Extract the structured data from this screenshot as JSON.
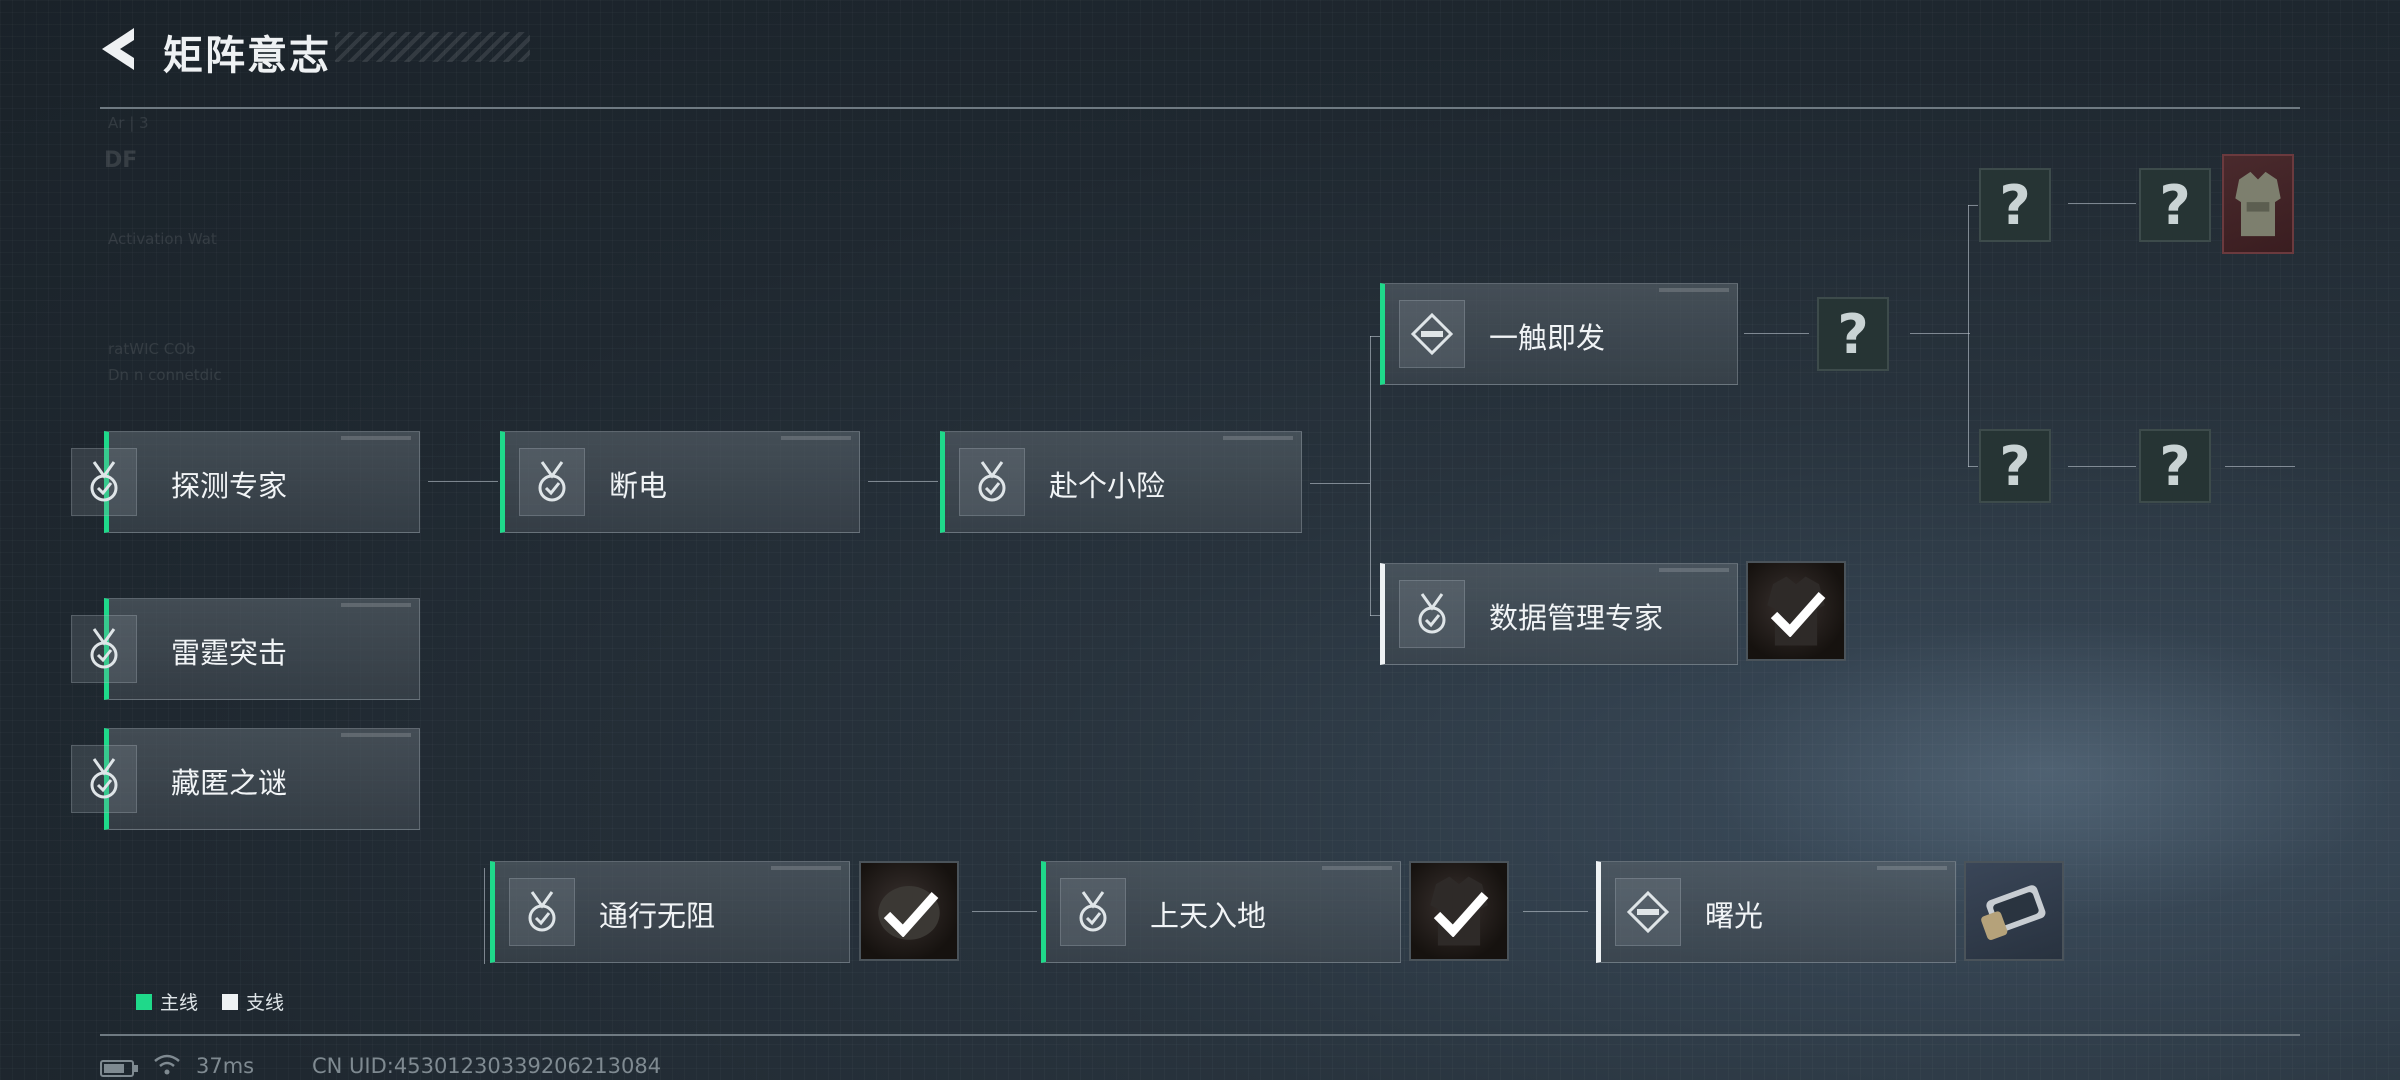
{
  "header": {
    "title": "矩阵意志"
  },
  "nodes": {
    "tance": {
      "label": "探测专家",
      "line": "main",
      "icon": "medal-check-icon"
    },
    "duandian": {
      "label": "断电",
      "line": "main",
      "icon": "medal-check-icon"
    },
    "fuge": {
      "label": "赴个小险",
      "line": "main",
      "icon": "medal-check-icon"
    },
    "yichu": {
      "label": "一触即发",
      "line": "main",
      "icon": "diamond-emblem-icon"
    },
    "shuju": {
      "label": "数据管理专家",
      "line": "side",
      "icon": "medal-check-icon"
    },
    "leiting": {
      "label": "雷霆突击",
      "line": "main",
      "icon": "medal-check-icon"
    },
    "canni": {
      "label": "藏匿之谜",
      "line": "main",
      "icon": "medal-check-icon"
    },
    "tongxing": {
      "label": "通行无阻",
      "line": "main",
      "icon": "medal-check-icon"
    },
    "shangtian": {
      "label": "上天入地",
      "line": "main",
      "icon": "medal-check-icon"
    },
    "shuguang": {
      "label": "曙光",
      "line": "side",
      "icon": "diamond-emblem-icon"
    }
  },
  "unknown_symbol": "?",
  "rewards": {
    "shuju": {
      "item": "armor-vest-icon",
      "claimed": true
    },
    "tongxing": {
      "item": "helmet-icon",
      "claimed": true
    },
    "shangtian": {
      "item": "armor-vest-icon",
      "claimed": true
    },
    "shuguang": {
      "item": "wristwatch-icon",
      "claimed": false
    },
    "top_right": {
      "item": "armor-vest-icon",
      "claimed": false
    }
  },
  "legend": [
    {
      "label": "主线",
      "color": "#1fd98a"
    },
    {
      "label": "支线",
      "color": "#eef2f4"
    }
  ],
  "status_bar": {
    "ping": "37ms",
    "uid": "CN UID:45301230339206213084"
  },
  "background_text": {
    "brand": "DF",
    "line1": "Ar | 3",
    "line2": "Activation Wat",
    "line3": "ratWIC COb",
    "line4": "Dn   n   connetdic"
  },
  "colors": {
    "main_line": "#1fd98a",
    "side_line": "#eef2f4",
    "background": "#222c34"
  }
}
